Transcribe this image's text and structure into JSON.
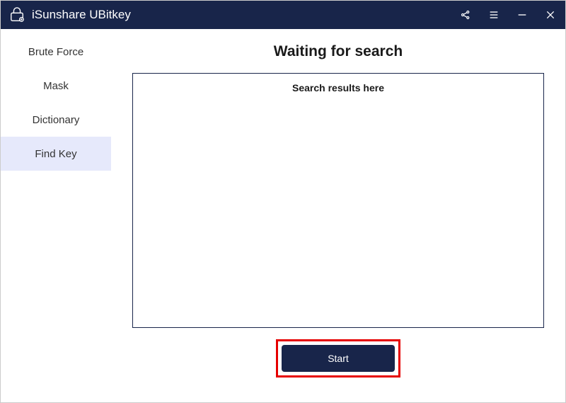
{
  "titlebar": {
    "appTitle": "iSunshare UBitkey"
  },
  "sidebar": {
    "items": [
      {
        "label": "Brute Force",
        "active": false
      },
      {
        "label": "Mask",
        "active": false
      },
      {
        "label": "Dictionary",
        "active": false
      },
      {
        "label": "Find Key",
        "active": true
      }
    ]
  },
  "main": {
    "pageTitle": "Waiting for search",
    "resultsPlaceholder": "Search results here",
    "startLabel": "Start"
  }
}
